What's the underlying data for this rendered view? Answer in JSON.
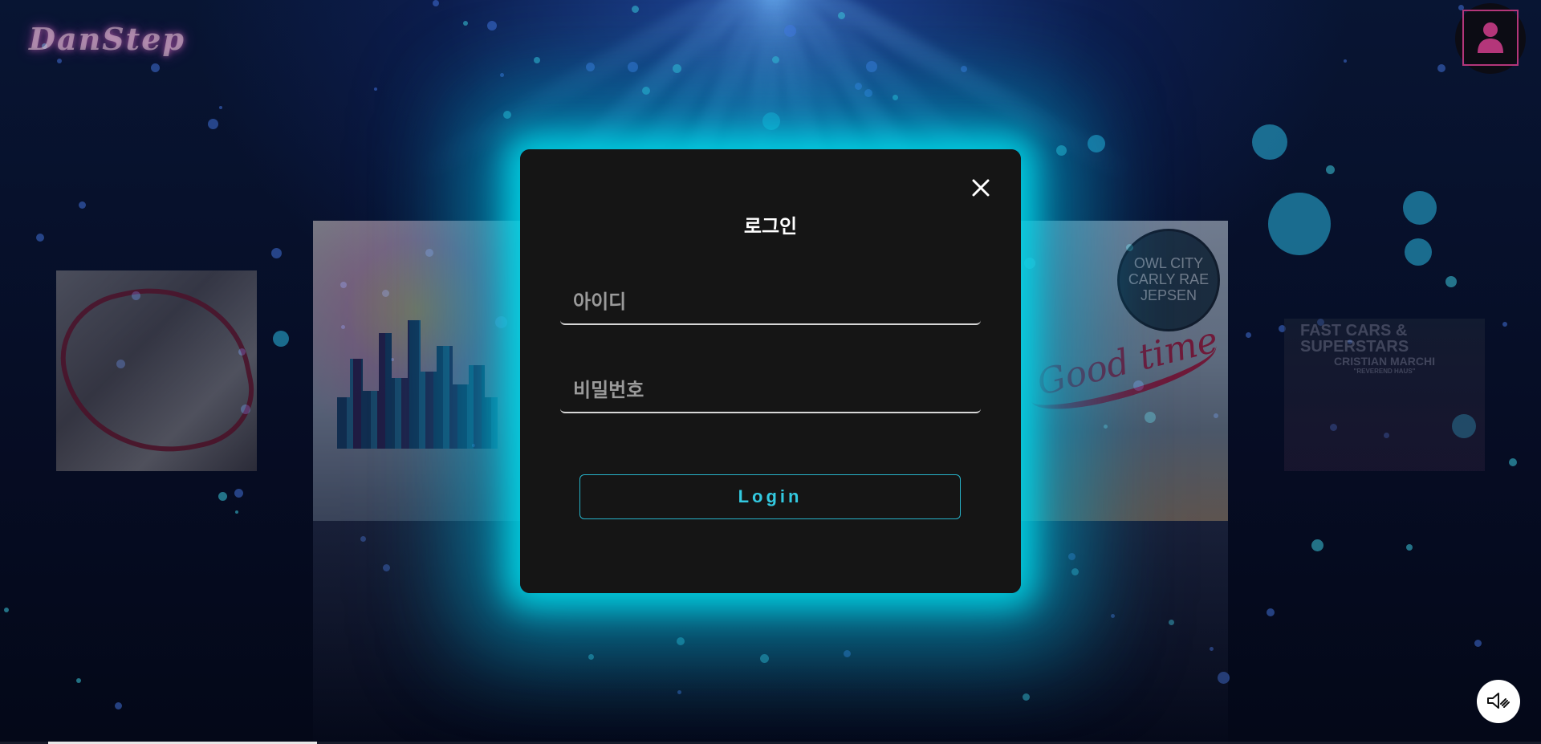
{
  "header": {
    "logo_text": "DanStep",
    "profile_icon": "user-icon"
  },
  "background": {
    "covers": [
      {
        "name": "far-left-cover"
      },
      {
        "name": "left-cover"
      },
      {
        "name": "right-cover",
        "badge_lines": [
          "OWL CITY",
          "CARLY RAE",
          "JEPSEN"
        ],
        "script_text": "Good time"
      },
      {
        "name": "far-right-cover",
        "title_lines": [
          "FAST CARS &",
          "SUPERSTARS"
        ],
        "artist": "CRISTIAN MARCHI",
        "subtitle": "\"REVEREND HAUS\""
      }
    ]
  },
  "login_modal": {
    "title": "로그인",
    "close_icon": "close-icon",
    "id_field": {
      "placeholder": "아이디",
      "value": ""
    },
    "password_field": {
      "placeholder": "비밀번호",
      "value": ""
    },
    "submit_label": "Login"
  },
  "controls": {
    "sound_icon": "speaker-muted-icon",
    "playback_progress": 0.18
  },
  "colors": {
    "accent": "#27b3c9",
    "glow": "#00dceb",
    "modal_bg": "#151515",
    "avatar_frame": "#b4367a"
  }
}
